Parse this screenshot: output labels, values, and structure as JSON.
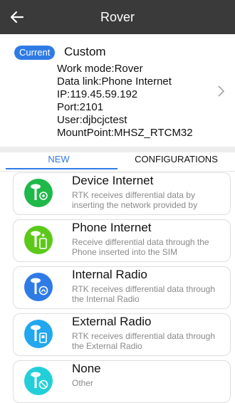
{
  "header": {
    "title": "Rover"
  },
  "current_config": {
    "badge": "Current",
    "name": "Custom",
    "work_mode": "Work mode:Rover",
    "data_link": "Data link:Phone Internet",
    "ip": "IP:119.45.59.192",
    "port": "Port:2101",
    "user": "User:djbcjctest",
    "mountpoint": "MountPoint:MHSZ_RTCM32"
  },
  "tabs": {
    "new": "NEW",
    "configurations": "CONFIGURATIONS"
  },
  "options": [
    {
      "title": "Device Internet",
      "desc": "RTK receives differential data by inserting the network provided by",
      "color": "#1fb84a",
      "icon": "device-internet-icon"
    },
    {
      "title": "Phone Internet",
      "desc": "Receive differential data through the Phone inserted into the SIM",
      "color": "#5cc91a",
      "icon": "phone-internet-icon"
    },
    {
      "title": "Internal Radio",
      "desc": "RTK receives differential data through the Internal Radio",
      "color": "#2f7be6",
      "icon": "internal-radio-icon"
    },
    {
      "title": "External Radio",
      "desc": "RTK receives differential data through the External Radio",
      "color": "#23a7ef",
      "icon": "external-radio-icon"
    },
    {
      "title": "None",
      "desc": "Other",
      "color": "#22cfd9",
      "icon": "none-icon"
    }
  ]
}
